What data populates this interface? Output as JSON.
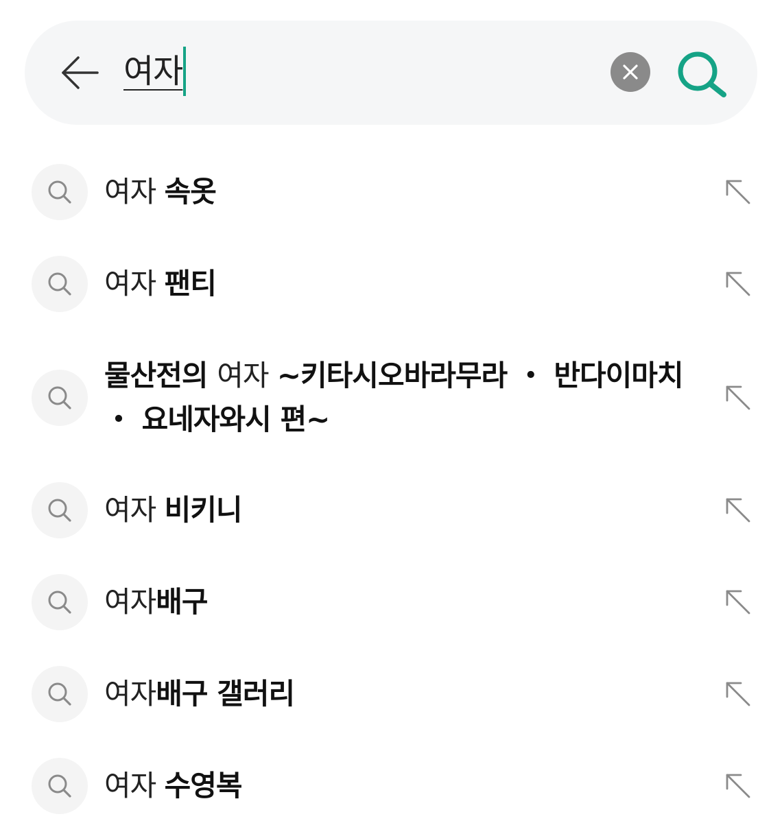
{
  "search": {
    "query": "여자"
  },
  "suggestions": [
    {
      "parts": [
        {
          "text": "여자 ",
          "bold": false
        },
        {
          "text": "속옷",
          "bold": true
        }
      ]
    },
    {
      "parts": [
        {
          "text": "여자 ",
          "bold": false
        },
        {
          "text": "팬티",
          "bold": true
        }
      ]
    },
    {
      "parts": [
        {
          "text": "물산전의 ",
          "bold": true
        },
        {
          "text": "여자 ",
          "bold": false
        },
        {
          "text": "~키타시오바라무라 ・ 반다이마치 ・ 요네자와시 편~",
          "bold": true
        }
      ]
    },
    {
      "parts": [
        {
          "text": "여자 ",
          "bold": false
        },
        {
          "text": "비키니",
          "bold": true
        }
      ]
    },
    {
      "parts": [
        {
          "text": "여자",
          "bold": false
        },
        {
          "text": "배구",
          "bold": true
        }
      ]
    },
    {
      "parts": [
        {
          "text": "여자",
          "bold": false
        },
        {
          "text": "배구 갤러리",
          "bold": true
        }
      ]
    },
    {
      "parts": [
        {
          "text": "여자 ",
          "bold": false
        },
        {
          "text": "수영복",
          "bold": true
        }
      ]
    }
  ],
  "icons": {
    "back": "arrow-left-icon",
    "clear": "close-circle-icon",
    "submit": "search-icon",
    "item": "search-icon",
    "fill": "arrow-up-left-icon"
  },
  "colors": {
    "accent": "#15a386",
    "search_bar_bg": "#f5f6f7",
    "clear_button_bg": "#8a8a8a"
  }
}
